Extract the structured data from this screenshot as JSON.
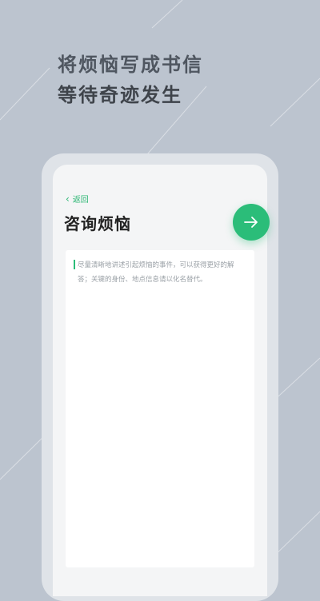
{
  "hero": {
    "line1": "将烦恼写成书信",
    "line2": "等待奇迹发生"
  },
  "screen": {
    "back_label": "返回",
    "title": "咨询烦恼",
    "input_placeholder": "尽量清晰地讲述引起烦恼的事件，可以获得更好的解答；关键的身份、地点信息请以化名替代。"
  },
  "icons": {
    "back": "chevron-left-icon",
    "next": "arrow-right-icon"
  },
  "colors": {
    "background": "#bcc4cf",
    "accent": "#2bbd79",
    "title_text": "#222222"
  }
}
